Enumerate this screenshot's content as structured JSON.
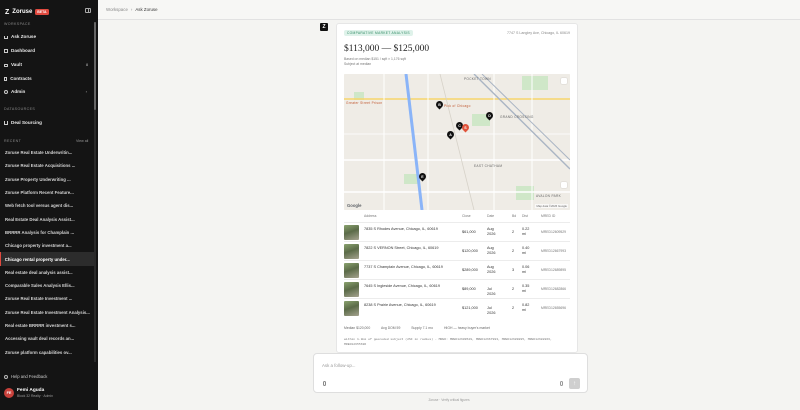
{
  "brand": {
    "name": "Zoruse",
    "badge": "BETA"
  },
  "sidebar": {
    "workspace_label": "WORKSPACE",
    "nav": [
      {
        "label": "Ask Zoruse"
      },
      {
        "label": "Dashboard"
      },
      {
        "label": "Vault",
        "badge": "8"
      },
      {
        "label": "Contracts"
      },
      {
        "label": "Admin"
      }
    ],
    "data_label": "DATASOURCES",
    "deal_sourcing": "Deal Sourcing",
    "recent_label": "RECENT",
    "view_all": "View all",
    "recent": [
      "Zoruse Real Estate Underwritin...",
      "Zoruse Real Estate Acquisitions ...",
      "Zoruse Property Underwriting ...",
      "Zoruse Platform Recent Feature...",
      "Web fetch tool versus agent dis...",
      "Real Estate Deal Analysis Assist...",
      "BRRRR Analysis for Champlain ...",
      "Chicago property investment a...",
      "Chicago rental property under...",
      "Real estate deal analysis assist...",
      "Comparable Sales Analysis Ellis...",
      "Zoruse Real Estate Investment ...",
      "Zoruse Real Estate Investment Analysis...",
      "Real estate BRRRR investment s...",
      "Accessing vault deal records an...",
      "Zoruse platform capabilities ov..."
    ],
    "help": "Help and Feedback",
    "user": {
      "initials": "FE",
      "name": "Femi Aguda",
      "sub": "Block 32 Realty · Admin"
    }
  },
  "breadcrumb": {
    "root": "Workspace",
    "sep": "›",
    "current": "Ask Zoruse"
  },
  "card": {
    "badge": "COMPARATIVE MARKET ANALYSIS",
    "address": "7747 S Langley Ave, Chicago, IL 60619",
    "price_range": "$113,000 — $125,000",
    "sub1": "Based on median $151 / sqft × 1,176 sqft",
    "sub2": "Subject at median",
    "map": {
      "labels": [
        "POCKET TOWN",
        "GRAND CROSSING",
        "EAST CHATHAM",
        "AVALON PARK",
        "Greater Street Prison",
        "Pick of Chicago"
      ],
      "attribution": "Map data ©2026 Google",
      "google": "Google",
      "pins": [
        "A",
        "B",
        "C",
        "D",
        "E",
        "S"
      ]
    },
    "table": {
      "headers": [
        "Address",
        "Close",
        "Date",
        "Bd",
        "Dist",
        "MRED ID"
      ],
      "rows": [
        {
          "address": "7835 S Rhodes Avenue, Chicago, IL, 60619",
          "close": "$61,000",
          "date": "Aug 2026",
          "bd": "2",
          "dist": "0.22 mi",
          "mls": "MRED12609529"
        },
        {
          "address": "7822 S VERNON Street, Chicago, IL, 60619",
          "close": "$120,000",
          "date": "Aug 2026",
          "bd": "2",
          "dist": "0.40 mi",
          "mls": "MRED12667993"
        },
        {
          "address": "7737 S Champlain Avenue, Chicago, IL, 60619",
          "close": "$289,000",
          "date": "Aug 2026",
          "bd": "3",
          "dist": "0.06 mi",
          "mls": "MRED12689895"
        },
        {
          "address": "7645 S Ingleside Avenue, Chicago, IL, 60619",
          "close": "$89,000",
          "date": "Jul 2026",
          "bd": "2",
          "dist": "0.35 mi",
          "mls": "MRED12682866"
        },
        {
          "address": "8238 S Prairie Avenue, Chicago, IL, 60619",
          "close": "$121,000",
          "date": "Jul 2026",
          "bd": "2",
          "dist": "0.82 mi",
          "mls": "MRED12655696"
        }
      ]
    },
    "summary": [
      "Median $120,000",
      "Avg DOM 59",
      "Supply 7.1 mo",
      "HIGH — heavy buyer's market"
    ],
    "note": "within 1.0mi of geocoded subject (2SI in radius) · MRED: MRED12609529, MRED12667993, MRED12689895, MRED12682866, MRED12655696"
  },
  "input": {
    "placeholder": "Ask a follow-up...",
    "send": "↑"
  },
  "footer": "Zoruse · Verify critical figures"
}
